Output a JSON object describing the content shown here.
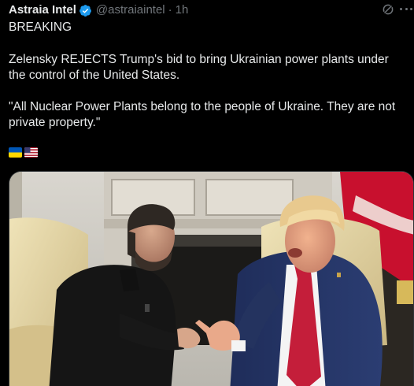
{
  "author": {
    "display_name": "Astraia Intel",
    "handle": "@astraiaintel",
    "separator": "·",
    "time": "1h",
    "verified_icon": "verified-badge-icon",
    "verified_color": "#1d9bf0"
  },
  "toolbar": {
    "grok_icon": "grok-icon",
    "more_icon": "more-options-icon"
  },
  "post": {
    "breaking": "BREAKING",
    "headline": "Zelensky REJECTS Trump's bid to bring Ukrainian power plants under the control of the United States.",
    "quote": "\"All Nuclear Power Plants belong to the people of Ukraine. They are not private property.\"",
    "flags": [
      "ukraine-flag-emoji",
      "us-flag-emoji"
    ]
  },
  "media": {
    "image_icon": "photo"
  },
  "colors": {
    "background": "#000000",
    "text": "#e7e9ea",
    "secondary_text": "#71767b",
    "accent": "#1d9bf0"
  }
}
